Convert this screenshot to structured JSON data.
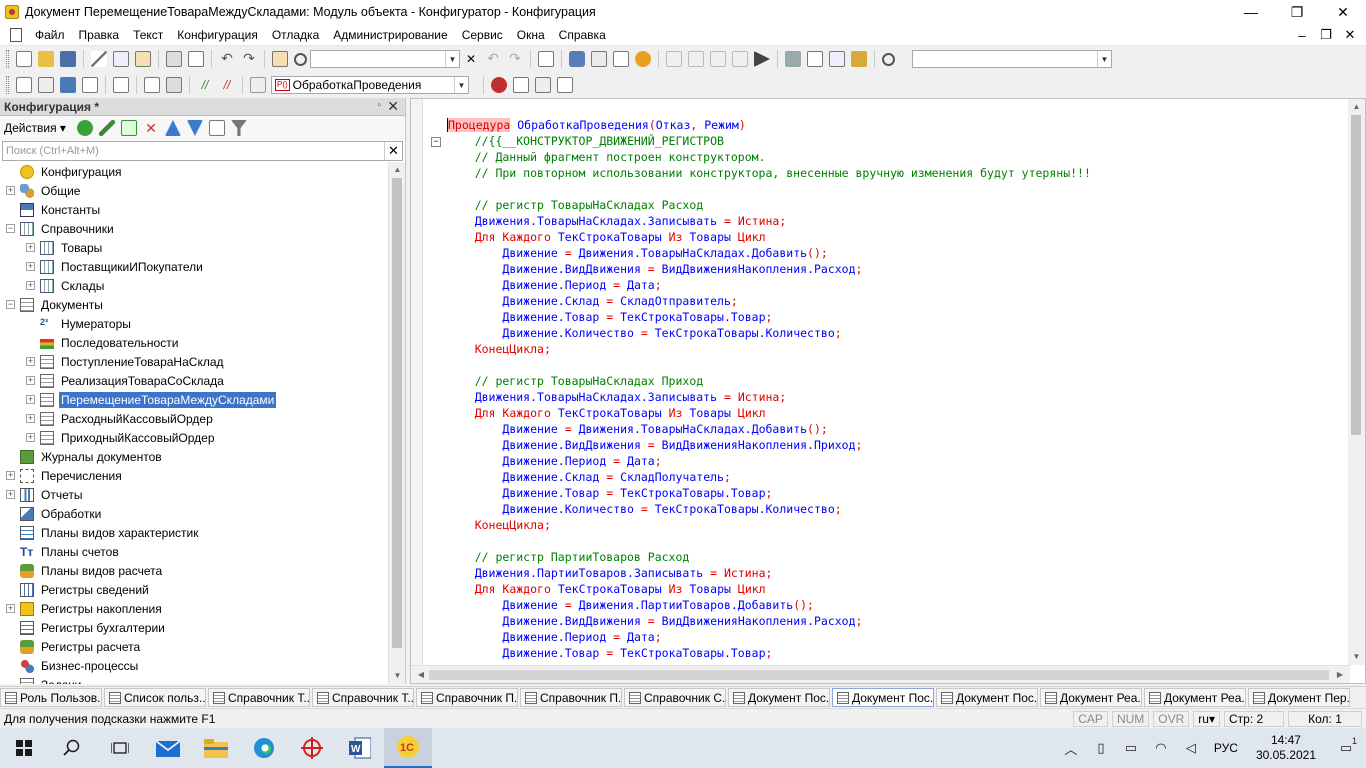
{
  "window": {
    "title": "Документ ПеремещениеТовараМеждуСкладами: Модуль объекта - Конфигуратор - Конфигурация",
    "minimize": "—",
    "maximize": "❐",
    "close": "✕"
  },
  "menu": {
    "items": [
      "Файл",
      "Правка",
      "Текст",
      "Конфигурация",
      "Отладка",
      "Администрирование",
      "Сервис",
      "Окна",
      "Справка"
    ],
    "mdi_minimize": "–",
    "mdi_restore": "❐",
    "mdi_close": "✕"
  },
  "toolbar2": {
    "procedure_combo": "ОбработкаПроведения",
    "procedure_tag": "Р()"
  },
  "left_panel": {
    "title": "Конфигурация *",
    "pin": "▫",
    "close": "✕",
    "actions_label": "Действия",
    "search_placeholder": "Поиск (Ctrl+Alt+M)",
    "search_clear": "✕",
    "tree": [
      {
        "label": "Конфигурация",
        "level": 0,
        "expander": "",
        "icon": "root"
      },
      {
        "label": "Общие",
        "level": 0,
        "expander": "+",
        "icon": "common"
      },
      {
        "label": "Константы",
        "level": 0,
        "expander": "",
        "icon": "const"
      },
      {
        "label": "Справочники",
        "level": 0,
        "expander": "−",
        "icon": "cat"
      },
      {
        "label": "Товары",
        "level": 1,
        "expander": "+",
        "icon": "cat"
      },
      {
        "label": "ПоставщикиИПокупатели",
        "level": 1,
        "expander": "+",
        "icon": "cat"
      },
      {
        "label": "Склады",
        "level": 1,
        "expander": "+",
        "icon": "cat"
      },
      {
        "label": "Документы",
        "level": 0,
        "expander": "−",
        "icon": "doc"
      },
      {
        "label": "Нумераторы",
        "level": 1,
        "expander": "",
        "icon": "num"
      },
      {
        "label": "Последовательности",
        "level": 1,
        "expander": "",
        "icon": "seq"
      },
      {
        "label": "ПоступлениеТовараНаСклад",
        "level": 1,
        "expander": "+",
        "icon": "doc"
      },
      {
        "label": "РеализацияТовараСоСклада",
        "level": 1,
        "expander": "+",
        "icon": "doc"
      },
      {
        "label": "ПеремещениеТовараМеждуСкладами",
        "level": 1,
        "expander": "+",
        "icon": "doc",
        "selected": true
      },
      {
        "label": "РасходныйКассовыйОрдер",
        "level": 1,
        "expander": "+",
        "icon": "doc"
      },
      {
        "label": "ПриходныйКассовыйОрдер",
        "level": 1,
        "expander": "+",
        "icon": "doc"
      },
      {
        "label": "Журналы документов",
        "level": 0,
        "expander": "",
        "icon": "journal"
      },
      {
        "label": "Перечисления",
        "level": 0,
        "expander": "+",
        "icon": "enum"
      },
      {
        "label": "Отчеты",
        "level": 0,
        "expander": "+",
        "icon": "report"
      },
      {
        "label": "Обработки",
        "level": 0,
        "expander": "",
        "icon": "proc"
      },
      {
        "label": "Планы видов характеристик",
        "level": 0,
        "expander": "",
        "icon": "plan"
      },
      {
        "label": "Планы счетов",
        "level": 0,
        "expander": "",
        "icon": "acct"
      },
      {
        "label": "Планы видов расчета",
        "level": 0,
        "expander": "",
        "icon": "calc"
      },
      {
        "label": "Регистры сведений",
        "level": 0,
        "expander": "",
        "icon": "info"
      },
      {
        "label": "Регистры накопления",
        "level": 0,
        "expander": "+",
        "icon": "accum"
      },
      {
        "label": "Регистры бухгалтерии",
        "level": 0,
        "expander": "",
        "icon": "plan"
      },
      {
        "label": "Регистры расчета",
        "level": 0,
        "expander": "",
        "icon": "calc"
      },
      {
        "label": "Бизнес-процессы",
        "level": 0,
        "expander": "",
        "icon": "bp"
      },
      {
        "label": "Задачи",
        "level": 0,
        "expander": "",
        "icon": "doc"
      }
    ]
  },
  "editor": {
    "lines": [
      [
        {
          "t": "Процедура",
          "c": "kw hl cursor-bar"
        },
        {
          "t": " ",
          "c": ""
        },
        {
          "t": "ОбработкаПроведения",
          "c": "id"
        },
        {
          "t": "(",
          "c": "op"
        },
        {
          "t": "Отказ",
          "c": "id"
        },
        {
          "t": ", ",
          "c": "op"
        },
        {
          "t": "Режим",
          "c": "id"
        },
        {
          "t": ")",
          "c": "op"
        }
      ],
      [
        {
          "t": "    //{{__КОНСТРУКТОР_ДВИЖЕНИЙ_РЕГИСТРОВ",
          "c": "cm"
        }
      ],
      [
        {
          "t": "    // Данный фрагмент построен конструктором.",
          "c": "cm"
        }
      ],
      [
        {
          "t": "    // При повторном использовании конструктора, внесенные вручную изменения будут утеряны!!!",
          "c": "cm"
        }
      ],
      [],
      [
        {
          "t": "    // регистр ТоварыНаСкладах Расход",
          "c": "cm"
        }
      ],
      [
        {
          "t": "    ",
          "c": ""
        },
        {
          "t": "Движения.ТоварыНаСкладах.Записывать",
          "c": "id"
        },
        {
          "t": " = ",
          "c": "op"
        },
        {
          "t": "Истина",
          "c": "kw"
        },
        {
          "t": ";",
          "c": "op"
        }
      ],
      [
        {
          "t": "    ",
          "c": ""
        },
        {
          "t": "Для Каждого",
          "c": "kw"
        },
        {
          "t": " ",
          "c": ""
        },
        {
          "t": "ТекСтрокаТовары",
          "c": "id"
        },
        {
          "t": " ",
          "c": ""
        },
        {
          "t": "Из",
          "c": "kw"
        },
        {
          "t": " ",
          "c": ""
        },
        {
          "t": "Товары",
          "c": "id"
        },
        {
          "t": " ",
          "c": ""
        },
        {
          "t": "Цикл",
          "c": "kw"
        }
      ],
      [
        {
          "t": "        ",
          "c": ""
        },
        {
          "t": "Движение",
          "c": "id"
        },
        {
          "t": " = ",
          "c": "op"
        },
        {
          "t": "Движения.ТоварыНаСкладах.Добавить",
          "c": "id"
        },
        {
          "t": "();",
          "c": "op"
        }
      ],
      [
        {
          "t": "        ",
          "c": ""
        },
        {
          "t": "Движение.ВидДвижения",
          "c": "id"
        },
        {
          "t": " = ",
          "c": "op"
        },
        {
          "t": "ВидДвиженияНакопления.Расход",
          "c": "id"
        },
        {
          "t": ";",
          "c": "op"
        }
      ],
      [
        {
          "t": "        ",
          "c": ""
        },
        {
          "t": "Движение.Период",
          "c": "id"
        },
        {
          "t": " = ",
          "c": "op"
        },
        {
          "t": "Дата",
          "c": "id"
        },
        {
          "t": ";",
          "c": "op"
        }
      ],
      [
        {
          "t": "        ",
          "c": ""
        },
        {
          "t": "Движение.Склад",
          "c": "id"
        },
        {
          "t": " = ",
          "c": "op"
        },
        {
          "t": "СкладОтправитель",
          "c": "id"
        },
        {
          "t": ";",
          "c": "op"
        }
      ],
      [
        {
          "t": "        ",
          "c": ""
        },
        {
          "t": "Движение.Товар",
          "c": "id"
        },
        {
          "t": " = ",
          "c": "op"
        },
        {
          "t": "ТекСтрокаТовары.Товар",
          "c": "id"
        },
        {
          "t": ";",
          "c": "op"
        }
      ],
      [
        {
          "t": "        ",
          "c": ""
        },
        {
          "t": "Движение.Количество",
          "c": "id"
        },
        {
          "t": " = ",
          "c": "op"
        },
        {
          "t": "ТекСтрокаТовары.Количество",
          "c": "id"
        },
        {
          "t": ";",
          "c": "op"
        }
      ],
      [
        {
          "t": "    ",
          "c": ""
        },
        {
          "t": "КонецЦикла",
          "c": "kw"
        },
        {
          "t": ";",
          "c": "op"
        }
      ],
      [],
      [
        {
          "t": "    // регистр ТоварыНаСкладах Приход",
          "c": "cm"
        }
      ],
      [
        {
          "t": "    ",
          "c": ""
        },
        {
          "t": "Движения.ТоварыНаСкладах.Записывать",
          "c": "id"
        },
        {
          "t": " = ",
          "c": "op"
        },
        {
          "t": "Истина",
          "c": "kw"
        },
        {
          "t": ";",
          "c": "op"
        }
      ],
      [
        {
          "t": "    ",
          "c": ""
        },
        {
          "t": "Для Каждого",
          "c": "kw"
        },
        {
          "t": " ",
          "c": ""
        },
        {
          "t": "ТекСтрокаТовары",
          "c": "id"
        },
        {
          "t": " ",
          "c": ""
        },
        {
          "t": "Из",
          "c": "kw"
        },
        {
          "t": " ",
          "c": ""
        },
        {
          "t": "Товары",
          "c": "id"
        },
        {
          "t": " ",
          "c": ""
        },
        {
          "t": "Цикл",
          "c": "kw"
        }
      ],
      [
        {
          "t": "        ",
          "c": ""
        },
        {
          "t": "Движение",
          "c": "id"
        },
        {
          "t": " = ",
          "c": "op"
        },
        {
          "t": "Движения.ТоварыНаСкладах.Добавить",
          "c": "id"
        },
        {
          "t": "();",
          "c": "op"
        }
      ],
      [
        {
          "t": "        ",
          "c": ""
        },
        {
          "t": "Движение.ВидДвижения",
          "c": "id"
        },
        {
          "t": " = ",
          "c": "op"
        },
        {
          "t": "ВидДвиженияНакопления.Приход",
          "c": "id"
        },
        {
          "t": ";",
          "c": "op"
        }
      ],
      [
        {
          "t": "        ",
          "c": ""
        },
        {
          "t": "Движение.Период",
          "c": "id"
        },
        {
          "t": " = ",
          "c": "op"
        },
        {
          "t": "Дата",
          "c": "id"
        },
        {
          "t": ";",
          "c": "op"
        }
      ],
      [
        {
          "t": "        ",
          "c": ""
        },
        {
          "t": "Движение.Склад",
          "c": "id"
        },
        {
          "t": " = ",
          "c": "op"
        },
        {
          "t": "СкладПолучатель",
          "c": "id"
        },
        {
          "t": ";",
          "c": "op"
        }
      ],
      [
        {
          "t": "        ",
          "c": ""
        },
        {
          "t": "Движение.Товар",
          "c": "id"
        },
        {
          "t": " = ",
          "c": "op"
        },
        {
          "t": "ТекСтрокаТовары.Товар",
          "c": "id"
        },
        {
          "t": ";",
          "c": "op"
        }
      ],
      [
        {
          "t": "        ",
          "c": ""
        },
        {
          "t": "Движение.Количество",
          "c": "id"
        },
        {
          "t": " = ",
          "c": "op"
        },
        {
          "t": "ТекСтрокаТовары.Количество",
          "c": "id"
        },
        {
          "t": ";",
          "c": "op"
        }
      ],
      [
        {
          "t": "    ",
          "c": ""
        },
        {
          "t": "КонецЦикла",
          "c": "kw"
        },
        {
          "t": ";",
          "c": "op"
        }
      ],
      [],
      [
        {
          "t": "    // регистр ПартииТоваров Расход",
          "c": "cm"
        }
      ],
      [
        {
          "t": "    ",
          "c": ""
        },
        {
          "t": "Движения.ПартииТоваров.Записывать",
          "c": "id"
        },
        {
          "t": " = ",
          "c": "op"
        },
        {
          "t": "Истина",
          "c": "kw"
        },
        {
          "t": ";",
          "c": "op"
        }
      ],
      [
        {
          "t": "    ",
          "c": ""
        },
        {
          "t": "Для Каждого",
          "c": "kw"
        },
        {
          "t": " ",
          "c": ""
        },
        {
          "t": "ТекСтрокаТовары",
          "c": "id"
        },
        {
          "t": " ",
          "c": ""
        },
        {
          "t": "Из",
          "c": "kw"
        },
        {
          "t": " ",
          "c": ""
        },
        {
          "t": "Товары",
          "c": "id"
        },
        {
          "t": " ",
          "c": ""
        },
        {
          "t": "Цикл",
          "c": "kw"
        }
      ],
      [
        {
          "t": "        ",
          "c": ""
        },
        {
          "t": "Движение",
          "c": "id"
        },
        {
          "t": " = ",
          "c": "op"
        },
        {
          "t": "Движения.ПартииТоваров.Добавить",
          "c": "id"
        },
        {
          "t": "();",
          "c": "op"
        }
      ],
      [
        {
          "t": "        ",
          "c": ""
        },
        {
          "t": "Движение.ВидДвижения",
          "c": "id"
        },
        {
          "t": " = ",
          "c": "op"
        },
        {
          "t": "ВидДвиженияНакопления.Расход",
          "c": "id"
        },
        {
          "t": ";",
          "c": "op"
        }
      ],
      [
        {
          "t": "        ",
          "c": ""
        },
        {
          "t": "Движение.Период",
          "c": "id"
        },
        {
          "t": " = ",
          "c": "op"
        },
        {
          "t": "Дата",
          "c": "id"
        },
        {
          "t": ";",
          "c": "op"
        }
      ],
      [
        {
          "t": "        ",
          "c": ""
        },
        {
          "t": "Движение.Товар",
          "c": "id"
        },
        {
          "t": " = ",
          "c": "op"
        },
        {
          "t": "ТекСтрокаТовары.Товар",
          "c": "id"
        },
        {
          "t": ";",
          "c": "op"
        }
      ]
    ],
    "fold_marker": "−"
  },
  "window_tabs": [
    {
      "label": "Роль Пользов...",
      "active": false
    },
    {
      "label": "Список польз...",
      "active": false
    },
    {
      "label": "Справочник Т...",
      "active": false
    },
    {
      "label": "Справочник Т...",
      "active": false
    },
    {
      "label": "Справочник П...",
      "active": false
    },
    {
      "label": "Справочник П...",
      "active": false
    },
    {
      "label": "Справочник С...",
      "active": false
    },
    {
      "label": "Документ Пос...",
      "active": false
    },
    {
      "label": "Документ Пос...",
      "active": true
    },
    {
      "label": "Документ Пос...",
      "active": false
    },
    {
      "label": "Документ Реа...",
      "active": false
    },
    {
      "label": "Документ Реа...",
      "active": false
    },
    {
      "label": "Документ Пер...",
      "active": false
    }
  ],
  "status": {
    "hint": "Для получения подсказки нажмите F1",
    "cap": "CAP",
    "num": "NUM",
    "ovr": "OVR",
    "lang": "ru",
    "line": "Стр: 2",
    "col": "Кол: 1"
  },
  "taskbar": {
    "lang": "РУС",
    "time": "14:47",
    "date": "30.05.2021",
    "notify_count": "1"
  },
  "colors": {
    "keyword": "#e00000",
    "identifier": "#0000ff",
    "comment": "#008000",
    "selection": "#3c74c9"
  }
}
